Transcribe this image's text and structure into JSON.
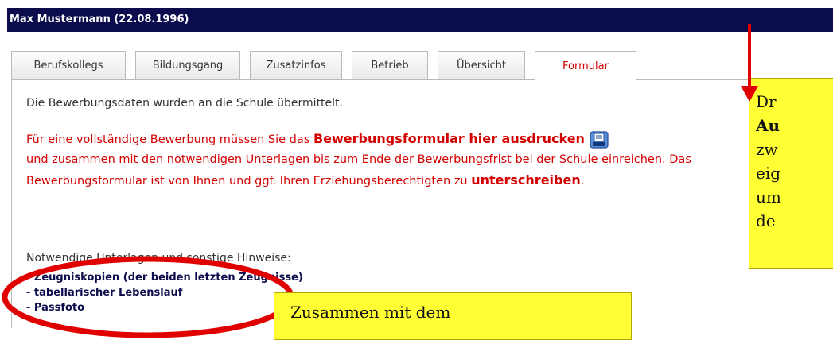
{
  "header": {
    "title": "Max Mustermann (22.08.1996)"
  },
  "tabs": [
    {
      "label": "Berufskollegs"
    },
    {
      "label": "Bildungsgang"
    },
    {
      "label": "Zusatzinfos"
    },
    {
      "label": "Betrieb"
    },
    {
      "label": "Übersicht"
    },
    {
      "label": "Formular"
    }
  ],
  "main": {
    "info": "Die Bewerbungsdaten wurden an die Schule übermittelt.",
    "text1": "Für eine vollständige Bewerbung müssen Sie das ",
    "bold_link": "Bewerbungsformular hier ausdrucken",
    "text2": "und zusammen mit den notwendigen Unterlagen bis zum Ende der Bewerbungsfrist bei der Schule einreichen. Das Bewerbungsformular ist von Ihnen und ggf. Ihren Erziehungsberechtigten zu ",
    "bold_sign": "unterschreiben",
    "text3": ".",
    "notes_title": "Notwendige Unterlagen und sonstige Hinweise:",
    "documents": [
      "- Zeugniskopien (der beiden letzten Zeugnisse)",
      "- tabellarischer Lebenslauf",
      "- Passfoto"
    ]
  },
  "callouts": {
    "right_lines": [
      "Dr",
      "Au",
      "zw",
      "eig",
      "um",
      "de"
    ],
    "bottom": "Zusammen mit dem"
  },
  "colors": {
    "header_bg": "#0b0c4c",
    "accent_red": "#d40000",
    "callout_yellow": "#ffff33"
  }
}
